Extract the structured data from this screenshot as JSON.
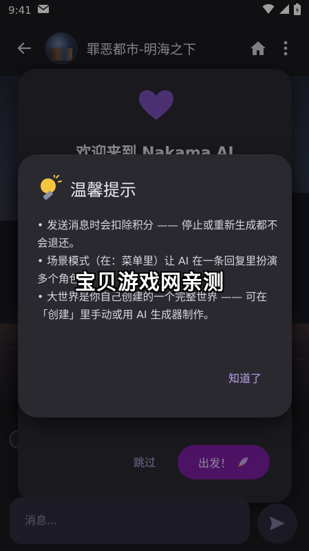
{
  "status_bar": {
    "time": "9:41"
  },
  "app_bar": {
    "title": "罪恶都市-明海之下"
  },
  "welcome": {
    "title": "欢迎来到 Nakama AI",
    "skip_label": "跳过",
    "go_label": "出发！"
  },
  "input": {
    "placeholder": "消息..."
  },
  "dialog": {
    "title": "温馨提示",
    "lines": [
      "• 发送消息时会扣除积分 —— 停止或重新生成都不会退还。",
      "• 场景模式（在：菜单里）让 AI 在一条回复里扮演多个角色。",
      "• 大世界是你自己创建的一个完整世界 —— 可在「创建」里手动或用 AI 生成器制作。"
    ],
    "ok_label": "知道了"
  },
  "watermark": "宝贝游戏网亲测",
  "colors": {
    "accent": "#7b1fa2",
    "link": "#b8a2e8",
    "surface": "#2b2930"
  }
}
